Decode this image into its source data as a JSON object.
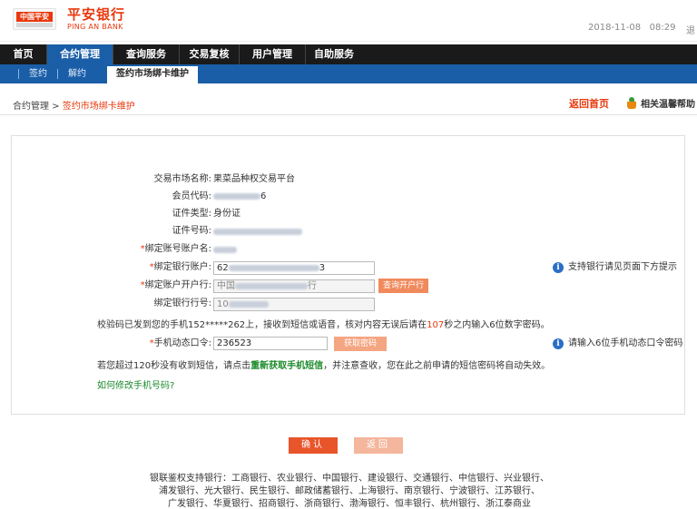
{
  "header": {
    "logo_box_label": "中国平安",
    "brand_cn": "平安银行",
    "brand_en": "PING AN BANK",
    "date": "2018-11-08",
    "time": "08:29",
    "logout": "退"
  },
  "main_nav": [
    {
      "label": "首页"
    },
    {
      "label": "合约管理"
    },
    {
      "label": "查询服务"
    },
    {
      "label": "交易复核"
    },
    {
      "label": "用户管理"
    },
    {
      "label": "自助服务"
    }
  ],
  "sub_nav": [
    {
      "label": "签约"
    },
    {
      "label": "解约"
    },
    {
      "label": "签约市场绑卡维护"
    }
  ],
  "breadcrumb": {
    "parent": "合约管理",
    "separator": " > ",
    "current": "签约市场绑卡维护"
  },
  "actions": {
    "back_home": "返回首页",
    "help": "相关温馨帮助"
  },
  "form": {
    "market_name_label": "交易市场名称:",
    "market_name_value": "果菜品种权交易平台",
    "member_code_label": "会员代码:",
    "member_code_value_suffix": "6",
    "cert_type_label": "证件类型:",
    "cert_type_value": "身份证",
    "cert_no_label": "证件号码:",
    "account_name_label": "绑定账号账户名:",
    "bank_account_label": "绑定银行账户:",
    "bank_account_value_start": "62",
    "bank_account_value_end": "3",
    "account_bank_label": "绑定账户开户行:",
    "account_bank_value_start": "中国",
    "account_bank_value_end": "行",
    "query_bank_button": "查询开户行",
    "bank_code_label": "绑定银行行号:",
    "bank_code_value_start": "10",
    "required_mark": "*",
    "sms_notice_prefix": "校验码已发到您的手机152*****262上，接收到短信或语音，核对内容无误后请在",
    "sms_notice_seconds": "107",
    "sms_notice_suffix": "秒之内输入6位数字密码。",
    "otp_label": "手机动态口令:",
    "otp_value": "236523",
    "get_otp_button": "获取密码",
    "resend_notice_prefix": "若您超过120秒没有收到短信，请点击",
    "resend_link": "重新获取手机短信",
    "resend_notice_suffix": "，并注意查收，您在此之前申请的短信密码将自动失效。",
    "change_phone_link": "如何修改手机号码?",
    "hint_supported_banks": "支持银行请见页面下方提示",
    "hint_otp": "请输入6位手机动态口令密码"
  },
  "buttons": {
    "confirm": "确认",
    "back": "返回"
  },
  "banks_notice": {
    "line1": "银联鉴权支持银行：工商银行、农业银行、中国银行、建设银行、交通银行、中信银行、兴业银行、",
    "line2": "浦发银行、光大银行、民生银行、邮政储蓄银行、上海银行、南京银行、宁波银行、江苏银行、",
    "line3": "广发银行、华夏银行、招商银行、浙商银行、渤海银行、恒丰银行、杭州银行、浙江泰商业"
  },
  "colors": {
    "brand_orange": "#e8380d",
    "nav_black": "#1a1a1a",
    "nav_blue": "#1a5ea8",
    "link_green": "#1a8a2a",
    "info_blue": "#2a6fc4"
  }
}
